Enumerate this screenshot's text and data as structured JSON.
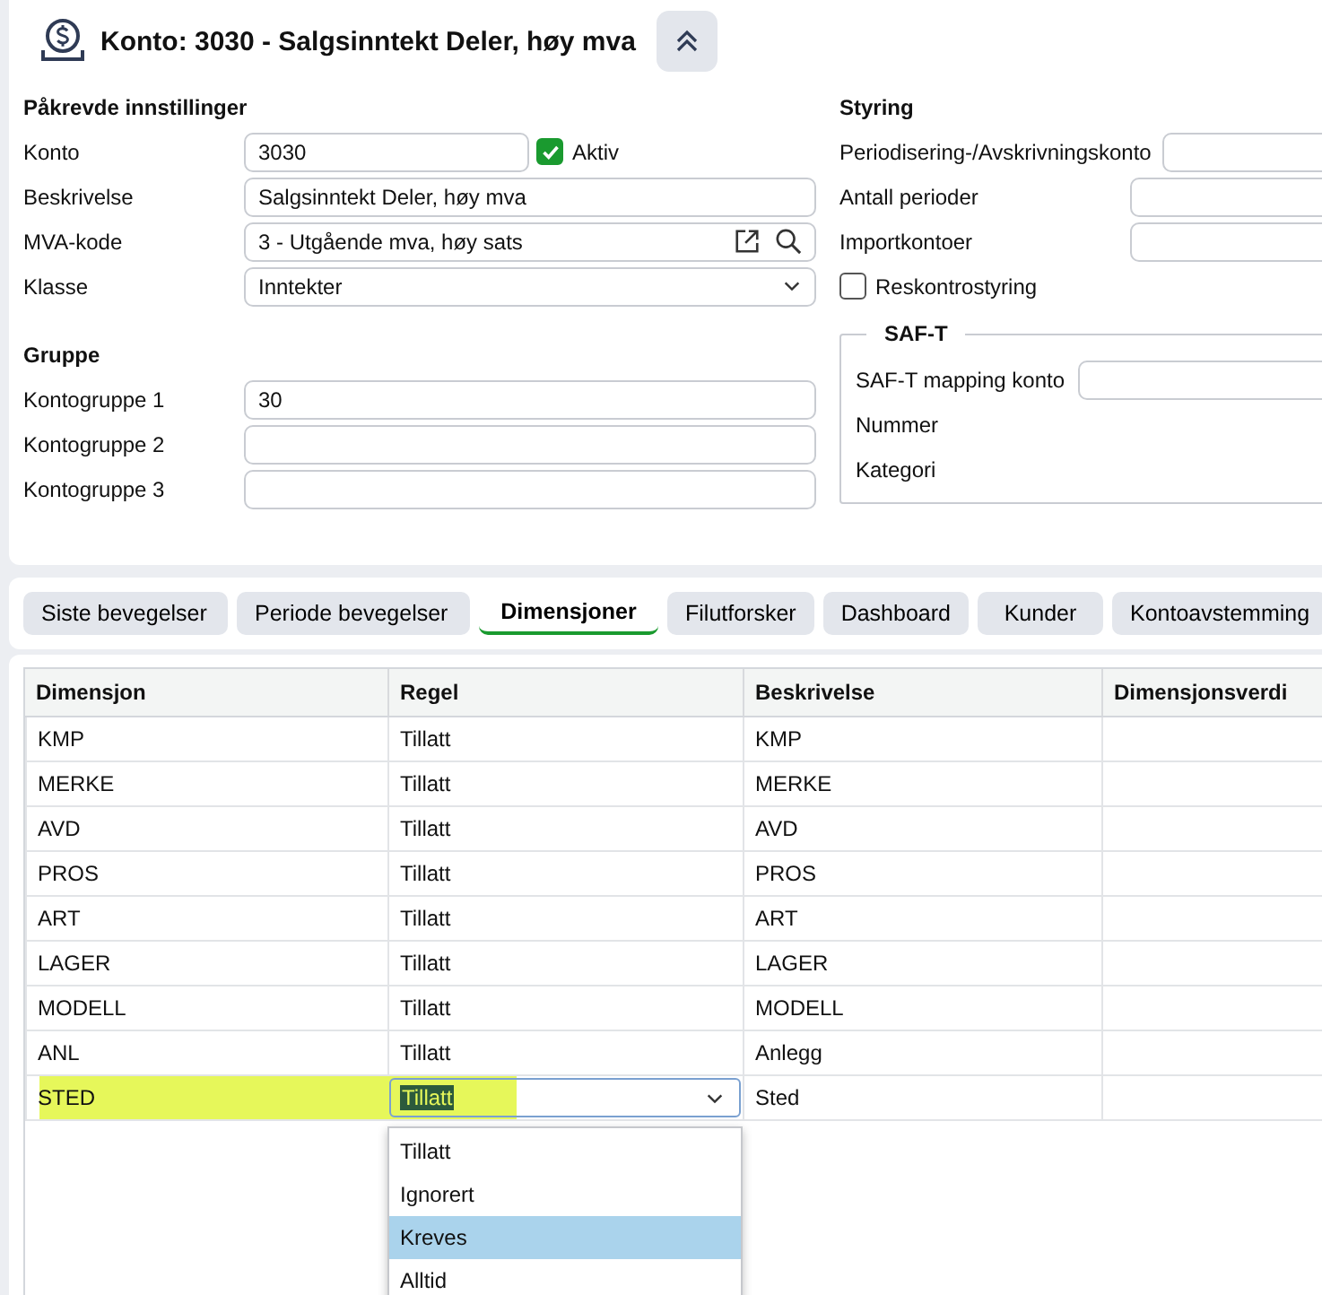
{
  "header": {
    "title": "Konto: 3030 - Salgsinntekt Deler, høy mva"
  },
  "required": {
    "heading": "Påkrevde innstillinger",
    "fields": [
      {
        "label": "Konto",
        "value": "3030",
        "kind": "short"
      },
      {
        "label": "Beskrivelse",
        "value": "Salgsinntekt Deler, høy mva",
        "kind": "text"
      },
      {
        "label": "MVA-kode",
        "value": "3 - Utgående mva, høy sats",
        "kind": "lookup"
      },
      {
        "label": "Klasse",
        "value": "Inntekter",
        "kind": "select"
      }
    ],
    "active": {
      "label": "Aktiv",
      "checked": true
    }
  },
  "group": {
    "heading": "Gruppe",
    "fields": [
      {
        "label": "Kontogruppe 1",
        "value": "30",
        "kind": "text"
      },
      {
        "label": "Kontogruppe 2",
        "kind": "text"
      },
      {
        "label": "Kontogruppe 3",
        "kind": "text"
      }
    ]
  },
  "control": {
    "heading": "Styring",
    "fields": [
      {
        "label": "Periodisering-/Avskrivningskonto"
      },
      {
        "label": "Antall perioder"
      },
      {
        "label": "Importkontoer"
      }
    ],
    "checkbox": {
      "label": "Reskontrostyring",
      "checked": false
    }
  },
  "saft": {
    "legend": "SAF-T",
    "fields": [
      {
        "label": "SAF-T mapping konto",
        "kind": "input"
      },
      {
        "label": "Nummer",
        "kind": "static"
      },
      {
        "label": "Kategori",
        "kind": "static"
      }
    ]
  },
  "tabs": [
    {
      "label": "Siste bevegelser",
      "selected": false
    },
    {
      "label": "Periode bevegelser",
      "selected": false
    },
    {
      "label": "Dimensjoner",
      "selected": true
    },
    {
      "label": "Filutforsker",
      "selected": false
    },
    {
      "label": "Dashboard",
      "selected": false
    },
    {
      "label": "Kunder",
      "selected": false
    },
    {
      "label": "Kontoavstemming",
      "selected": false
    }
  ],
  "table": {
    "columns": [
      "Dimensjon",
      "Regel",
      "Beskrivelse",
      "Dimensjonsverdi"
    ],
    "rows": [
      {
        "cells": [
          "KMP",
          "Tillatt",
          "KMP"
        ],
        "editing": false,
        "highlighted": false
      },
      {
        "cells": [
          "MERKE",
          "Tillatt",
          "MERKE"
        ],
        "editing": false,
        "highlighted": false
      },
      {
        "cells": [
          "AVD",
          "Tillatt",
          "AVD"
        ],
        "editing": false,
        "highlighted": false
      },
      {
        "cells": [
          "PROS",
          "Tillatt",
          "PROS"
        ],
        "editing": false,
        "highlighted": false
      },
      {
        "cells": [
          "ART",
          "Tillatt",
          "ART"
        ],
        "editing": false,
        "highlighted": false
      },
      {
        "cells": [
          "LAGER",
          "Tillatt",
          "LAGER"
        ],
        "editing": false,
        "highlighted": false
      },
      {
        "cells": [
          "MODELL",
          "Tillatt",
          "MODELL"
        ],
        "editing": false,
        "highlighted": false
      },
      {
        "cells": [
          "ANL",
          "Tillatt",
          "Anlegg"
        ],
        "editing": false,
        "highlighted": false
      },
      {
        "cells": [
          "STED",
          "Tillatt",
          "Sted"
        ],
        "editing": true,
        "highlighted": true
      }
    ],
    "dropdown": [
      {
        "label": "Tillatt",
        "selected": false
      },
      {
        "label": "Ignorert",
        "selected": false
      },
      {
        "label": "Kreves",
        "selected": true
      },
      {
        "label": "Alltid",
        "selected": false
      }
    ]
  }
}
